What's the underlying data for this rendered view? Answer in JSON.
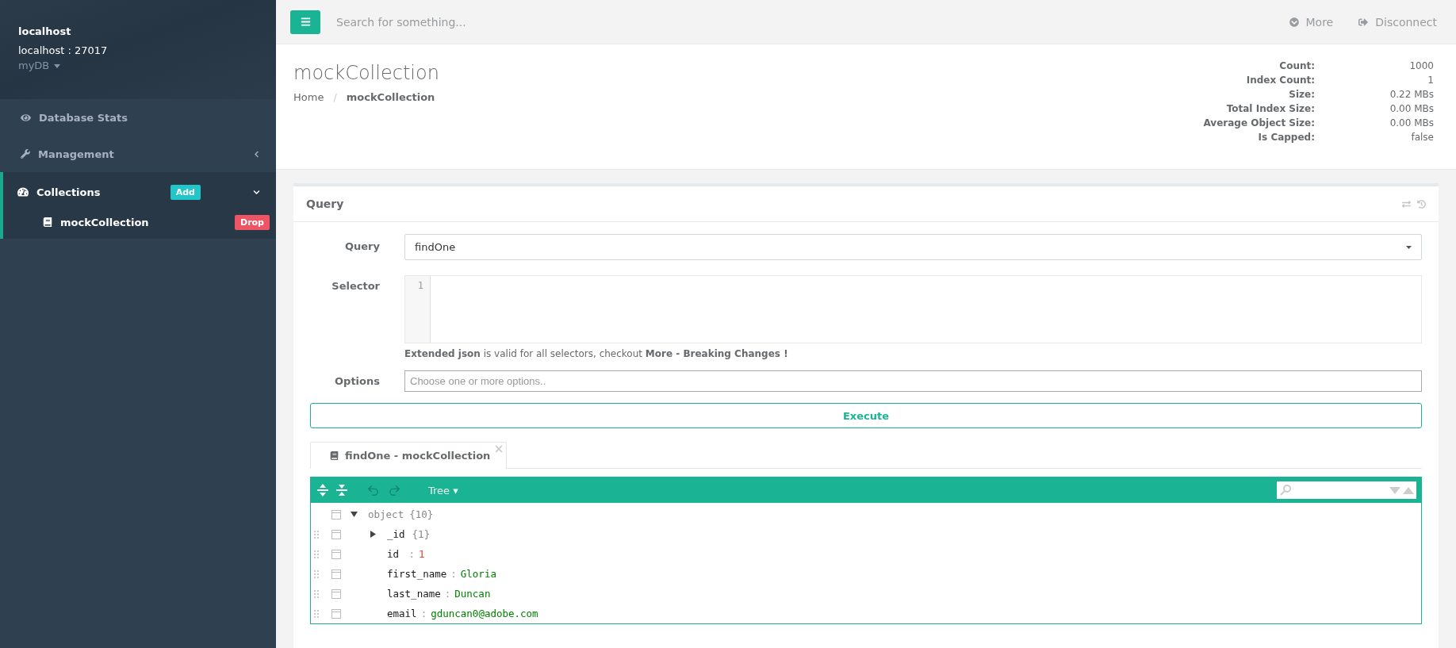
{
  "sidebar": {
    "connection": {
      "name": "localhost",
      "address": "localhost : 27017",
      "database": "myDB"
    },
    "nav": [
      {
        "kind": "stats",
        "label": "Database Stats",
        "selected": false
      },
      {
        "kind": "management",
        "label": "Management",
        "selected": false,
        "expanded": false
      },
      {
        "kind": "collections",
        "label": "Collections",
        "selected": true,
        "expanded": true,
        "badge": "Add",
        "children": [
          {
            "label": "mockCollection",
            "badge": "Drop"
          }
        ]
      }
    ]
  },
  "topbar": {
    "search": {
      "placeholder": "Search for something..."
    },
    "actions": [
      {
        "kind": "more",
        "label": "More"
      },
      {
        "kind": "disconnect",
        "label": "Disconnect"
      }
    ]
  },
  "header": {
    "title": "mockCollection",
    "breadcrumb": [
      {
        "label": "Home",
        "selected": false
      },
      {
        "label": "/",
        "kind": "separator"
      },
      {
        "label": "mockCollection",
        "selected": true
      }
    ],
    "stats": [
      {
        "label": "Count:",
        "value": "1000"
      },
      {
        "label": "Index Count:",
        "value": "1"
      },
      {
        "label": "Size:",
        "value": "0.22 MBs"
      },
      {
        "label": "Total Index Size:",
        "value": "0.00 MBs"
      },
      {
        "label": "Average Object Size:",
        "value": "0.00 MBs"
      },
      {
        "label": "Is Capped:",
        "value": "false"
      }
    ]
  },
  "query_panel": {
    "title": "Query",
    "query": {
      "label": "Query",
      "value": "findOne"
    },
    "selector": {
      "label": "Selector",
      "line_numbers": [
        "1"
      ]
    },
    "help": "**Extended json** is valid for all selectors, checkout **More - Breaking Changes !**",
    "options": {
      "label": "Options",
      "placeholder": "Choose one or more options.."
    },
    "execute": "Execute",
    "result_tabs": [
      {
        "label": "findOne - mockCollection",
        "selected": true,
        "close": "×"
      }
    ],
    "editor": {
      "mode": "Tree ▾",
      "tree": {
        "key": "object",
        "kind": "object",
        "summary": "{10}",
        "expanded": true,
        "children": [
          {
            "key": "_id",
            "kind": "object",
            "summary": "{1}",
            "expanded": false
          },
          {
            "key": "id ",
            "separator": ":",
            "kind": "number",
            "value": "1"
          },
          {
            "key": "first_name",
            "separator": ":",
            "kind": "string",
            "value": "Gloria"
          },
          {
            "key": "last_name",
            "separator": ":",
            "kind": "string",
            "value": "Duncan"
          },
          {
            "key": "email",
            "separator": ":",
            "kind": "string",
            "value": "gduncan0@adobe.com"
          }
        ]
      }
    }
  }
}
